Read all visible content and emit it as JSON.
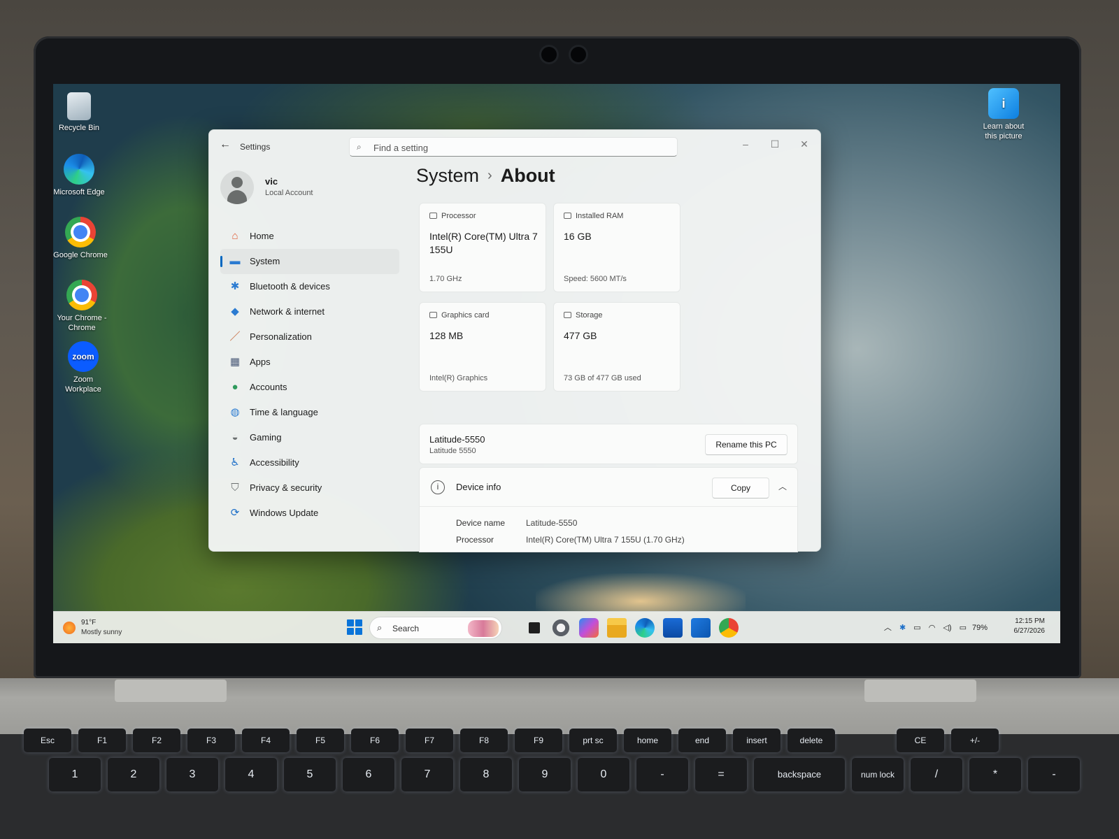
{
  "desktop": {
    "icons": [
      {
        "label": "Recycle Bin"
      },
      {
        "label": "Microsoft Edge"
      },
      {
        "label": "Google Chrome"
      },
      {
        "label": "Your Chrome - Chrome"
      },
      {
        "label": "Zoom Workplace",
        "glyph": "zoom"
      },
      {
        "label": "Learn about this picture"
      }
    ]
  },
  "settings": {
    "app_title": "Settings",
    "search_placeholder": "Find a setting",
    "user": {
      "name": "vic",
      "account_type": "Local Account"
    },
    "nav": [
      {
        "label": "Home",
        "icon": "home-icon",
        "color": "#e05a33"
      },
      {
        "label": "System",
        "icon": "system-icon",
        "color": "#2b7bd1",
        "active": true
      },
      {
        "label": "Bluetooth & devices",
        "icon": "bluetooth-icon",
        "color": "#2b7bd1"
      },
      {
        "label": "Network & internet",
        "icon": "network-icon",
        "color": "#2b7bd1"
      },
      {
        "label": "Personalization",
        "icon": "brush-icon",
        "color": "#c25b2b"
      },
      {
        "label": "Apps",
        "icon": "apps-icon",
        "color": "#4a5a78"
      },
      {
        "label": "Accounts",
        "icon": "accounts-icon",
        "color": "#2f9a5c"
      },
      {
        "label": "Time & language",
        "icon": "globe-icon",
        "color": "#2b7bd1"
      },
      {
        "label": "Gaming",
        "icon": "gamepad-icon",
        "color": "#6b7070"
      },
      {
        "label": "Accessibility",
        "icon": "accessibility-icon",
        "color": "#1d6fc8"
      },
      {
        "label": "Privacy & security",
        "icon": "shield-icon",
        "color": "#6b7070"
      },
      {
        "label": "Windows Update",
        "icon": "update-icon",
        "color": "#1d6fc8"
      }
    ],
    "breadcrumb": {
      "parent": "System",
      "separator": "›",
      "current": "About"
    },
    "specs": {
      "processor": {
        "title": "Processor",
        "value": "Intel(R) Core(TM) Ultra 7 155U",
        "sub": "1.70 GHz"
      },
      "ram": {
        "title": "Installed RAM",
        "value": "16 GB",
        "sub": "Speed: 5600 MT/s"
      },
      "graphics": {
        "title": "Graphics card",
        "value": "128 MB",
        "sub": "Intel(R) Graphics"
      },
      "storage": {
        "title": "Storage",
        "value": "477 GB",
        "sub": "73 GB of 477 GB used"
      }
    },
    "pc": {
      "name": "Latitude-5550",
      "model": "Latitude 5550",
      "rename_label": "Rename this PC"
    },
    "device_info": {
      "title": "Device info",
      "copy_label": "Copy",
      "rows": [
        {
          "label": "Device name",
          "value": "Latitude-5550"
        },
        {
          "label": "Processor",
          "value": "Intel(R) Core(TM) Ultra 7 155U (1.70 GHz)"
        }
      ]
    }
  },
  "taskbar": {
    "weather": {
      "temp": "91°F",
      "desc": "Mostly sunny"
    },
    "search_label": "Search",
    "battery": "79%",
    "time": "12:15 PM",
    "date": "6/27/2026"
  },
  "keyboard": {
    "fn_row": [
      "Esc",
      "F1",
      "F2",
      "F3",
      "F4",
      "F5",
      "F6",
      "F7",
      "F8",
      "F9",
      "prt sc",
      "home",
      "end",
      "insert",
      "delete",
      "CE",
      "+/-"
    ],
    "num_row": [
      "1",
      "2",
      "3",
      "4",
      "5",
      "6",
      "7",
      "8",
      "9",
      "0",
      "-",
      "=",
      "backspace",
      "num lock",
      "/",
      "*",
      "-"
    ]
  }
}
